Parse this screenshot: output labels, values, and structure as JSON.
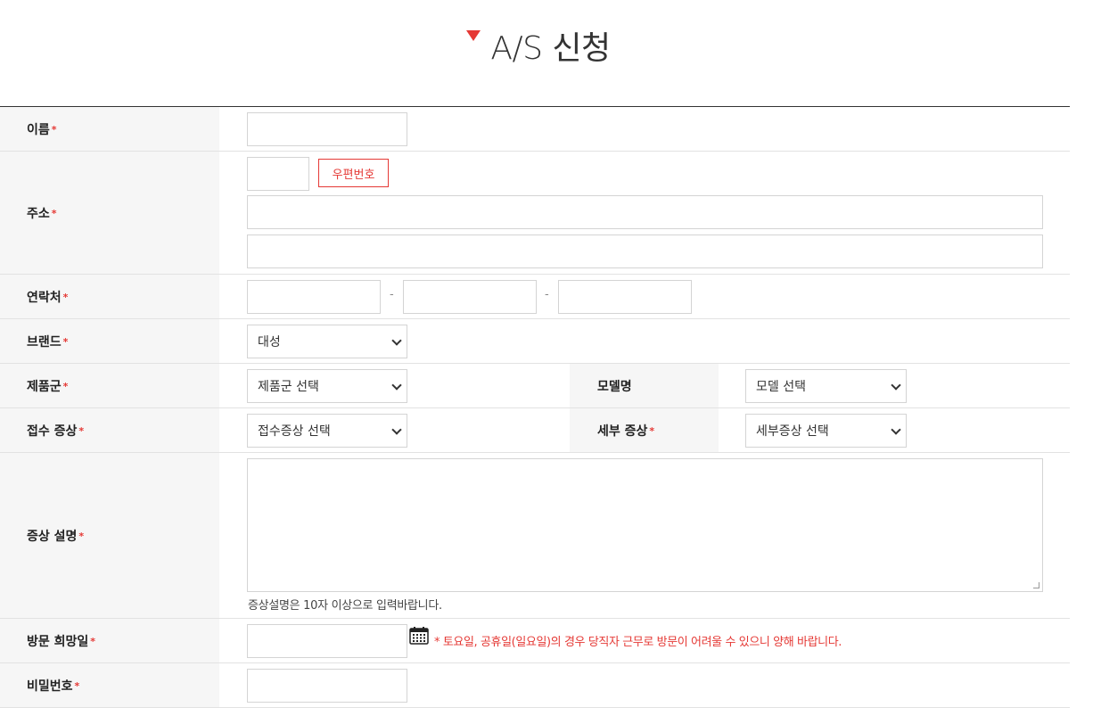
{
  "page": {
    "title": "A/S 신청"
  },
  "form": {
    "required_mark": "*",
    "name": {
      "label": "이름"
    },
    "address": {
      "label": "주소",
      "zip_button": "우편번호"
    },
    "phone": {
      "label": "연락처",
      "separator": "-"
    },
    "brand": {
      "label": "브랜드",
      "selected": "대성"
    },
    "product": {
      "label": "제품군",
      "selected": "제품군 선택"
    },
    "model": {
      "label": "모델명",
      "selected": "모델 선택"
    },
    "symptom": {
      "label": "접수 증상",
      "selected": "접수증상 선택"
    },
    "detail_symptom": {
      "label": "세부 증상",
      "selected": "세부증상 선택"
    },
    "description": {
      "label": "증상 설명",
      "hint": "증상설명은 10자 이상으로 입력바랍니다."
    },
    "visit_date": {
      "label": "방문 희망일",
      "notice": "* 토요일, 공휴일(일요일)의 경우 당직자 근무로 방문이 어려울 수 있으니 양해 바랍니다."
    },
    "password": {
      "label": "비밀번호"
    }
  },
  "colors": {
    "accent": "#e53935",
    "label_bg": "#f6f6f6",
    "border": "#d4d4d4"
  },
  "icons": {
    "title_marker": "red-triangle-icon",
    "calendar": "calendar-icon",
    "select_arrow": "chevron-down-icon"
  }
}
